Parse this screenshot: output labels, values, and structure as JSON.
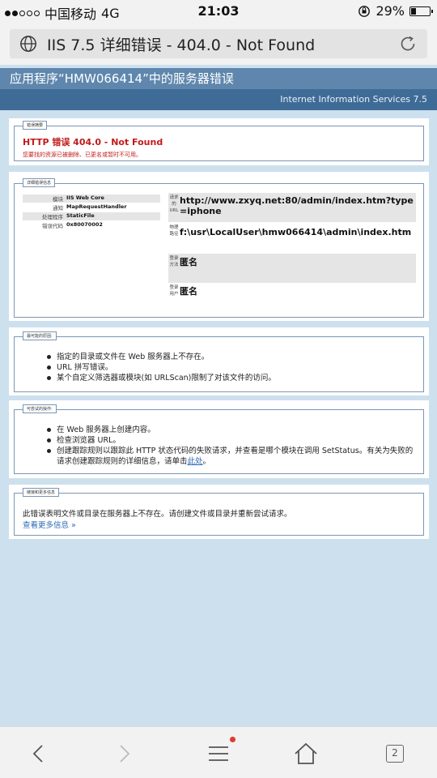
{
  "status_bar": {
    "carrier": "中国移动",
    "network": "4G",
    "time": "21:03",
    "battery": "29%",
    "battery_level": 0.29
  },
  "browser": {
    "page_title": "IIS 7.5 详细错误 - 404.0 - Not Found",
    "tab_count": "2"
  },
  "header": {
    "app_title": "应用程序“HMW066414”中的服务器错误",
    "server": "Internet Information Services 7.5"
  },
  "error_summary": {
    "legend": "错误摘要",
    "title": "HTTP 错误 404.0 - Not Found",
    "description": "您要找的资源已被删除、已更名或暂时不可用。"
  },
  "details": {
    "legend": "详细错误信息",
    "rows": [
      {
        "label": "模块",
        "value": "IIS Web Core"
      },
      {
        "label": "通知",
        "value": "MapRequestHandler"
      },
      {
        "label": "处理程序",
        "value": "StaticFile"
      },
      {
        "label": "错误代码",
        "value": "0x80070002"
      }
    ],
    "info": [
      {
        "label": "请求的URL",
        "value": "http://www.zxyq.net:80/admin/index.htm?type=iphone"
      },
      {
        "label": "物理路径",
        "value": "f:\\usr\\LocalUser\\hmw066414\\admin\\index.htm"
      },
      {
        "label": "登录方法",
        "value": "匿名"
      },
      {
        "label": "登录用户",
        "value": "匿名"
      }
    ]
  },
  "causes": {
    "legend": "最可能的原因:",
    "items": [
      "指定的目录或文件在 Web 服务器上不存在。",
      "URL 拼写错误。",
      "某个自定义筛选器或模块(如 URLScan)限制了对该文件的访问。"
    ]
  },
  "actions": {
    "legend": "可尝试的操作:",
    "items": [
      "在 Web 服务器上创建内容。",
      "检查浏览器 URL。",
      "创建跟踪规则以跟踪此 HTTP 状态代码的失败请求，并查看是哪个模块在调用 SetStatus。有关为失败的请求创建跟踪规则的详细信息，请单击"
    ],
    "link_text": "此处",
    "link_suffix": "。"
  },
  "more_info": {
    "legend": "链接和更多信息",
    "text": "此错误表明文件或目录在服务器上不存在。请创建文件或目录并重新尝试请求。",
    "link": "查看更多信息 »"
  }
}
